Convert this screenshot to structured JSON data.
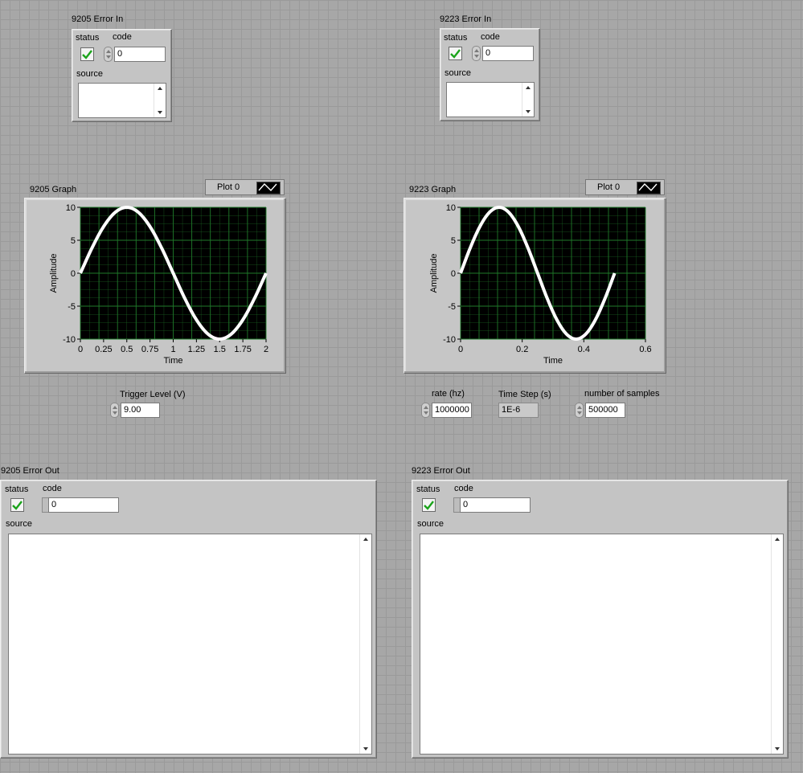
{
  "colors": {
    "panel": "#a7a7a7",
    "plot_bg": "#000000",
    "plot_grid": "#1f7a2a",
    "trace": "#ffffff",
    "status_check": "#1aa31a"
  },
  "error_in_9205": {
    "title": "9205 Error In",
    "status_label": "status",
    "code_label": "code",
    "code_value": "0",
    "source_label": "source",
    "source_value": "",
    "status_icon": "check-icon"
  },
  "error_in_9223": {
    "title": "9223 Error In",
    "status_label": "status",
    "code_label": "code",
    "code_value": "0",
    "source_label": "source",
    "source_value": "",
    "status_icon": "check-icon"
  },
  "graph_9205": {
    "title": "9205 Graph",
    "legend_label": "Plot 0",
    "xlabel": "Time",
    "ylabel": "Amplitude"
  },
  "graph_9223": {
    "title": "9223 Graph",
    "legend_label": "Plot 0",
    "xlabel": "Time",
    "ylabel": "Amplitude"
  },
  "trigger": {
    "label": "Trigger Level (V)",
    "value": "9.00"
  },
  "rate": {
    "label": "rate (hz)",
    "value": "1000000"
  },
  "time_step": {
    "label": "Time Step (s)",
    "value": "1E-6"
  },
  "num_samples": {
    "label": "number of samples",
    "value": "500000"
  },
  "error_out_9205": {
    "title": "9205 Error Out",
    "status_label": "status",
    "code_label": "code",
    "code_value": "0",
    "source_label": "source",
    "source_value": "",
    "status_icon": "check-icon"
  },
  "error_out_9223": {
    "title": "9223 Error Out",
    "status_label": "status",
    "code_label": "code",
    "code_value": "0",
    "source_label": "source",
    "source_value": "",
    "status_icon": "check-icon"
  },
  "chart_data": [
    {
      "type": "line",
      "xlabel": "Time",
      "ylabel": "Amplitude",
      "xlim": [
        0,
        2
      ],
      "ylim": [
        -10,
        10
      ],
      "xticks": [
        "0",
        "0.25",
        "0.5",
        "0.75",
        "1",
        "1.25",
        "1.5",
        "1.75",
        "2"
      ],
      "yticks": [
        "10",
        "5",
        "0",
        "-5",
        "-10"
      ],
      "grid": true,
      "legend": "top-right",
      "series": [
        {
          "name": "Plot 0",
          "x": [
            0,
            0.125,
            0.25,
            0.375,
            0.5,
            0.625,
            0.75,
            0.875,
            1,
            1.125,
            1.25,
            1.375,
            1.5,
            1.625,
            1.75,
            1.875,
            2
          ],
          "y": [
            0,
            3.83,
            7.07,
            9.24,
            10,
            9.24,
            7.07,
            3.83,
            0,
            -3.83,
            -7.07,
            -9.24,
            -10,
            -9.24,
            -7.07,
            -3.83,
            0
          ]
        }
      ]
    },
    {
      "type": "line",
      "xlabel": "Time",
      "ylabel": "Amplitude",
      "xlim": [
        0,
        0.6
      ],
      "ylim": [
        -10,
        10
      ],
      "xticks": [
        "0",
        "0.2",
        "0.4",
        "0.6"
      ],
      "yticks": [
        "10",
        "5",
        "0",
        "-5",
        "-10"
      ],
      "grid": true,
      "legend": "top-right",
      "series": [
        {
          "name": "Plot 0",
          "x": [
            0,
            0.03125,
            0.0625,
            0.09375,
            0.125,
            0.15625,
            0.1875,
            0.21875,
            0.25,
            0.28125,
            0.3125,
            0.34375,
            0.375,
            0.40625,
            0.4375,
            0.46875,
            0.5
          ],
          "y": [
            0,
            3.83,
            7.07,
            9.24,
            10,
            9.24,
            7.07,
            3.83,
            0,
            -3.83,
            -7.07,
            -9.24,
            -10,
            -9.24,
            -7.07,
            -3.83,
            0
          ]
        }
      ]
    }
  ]
}
